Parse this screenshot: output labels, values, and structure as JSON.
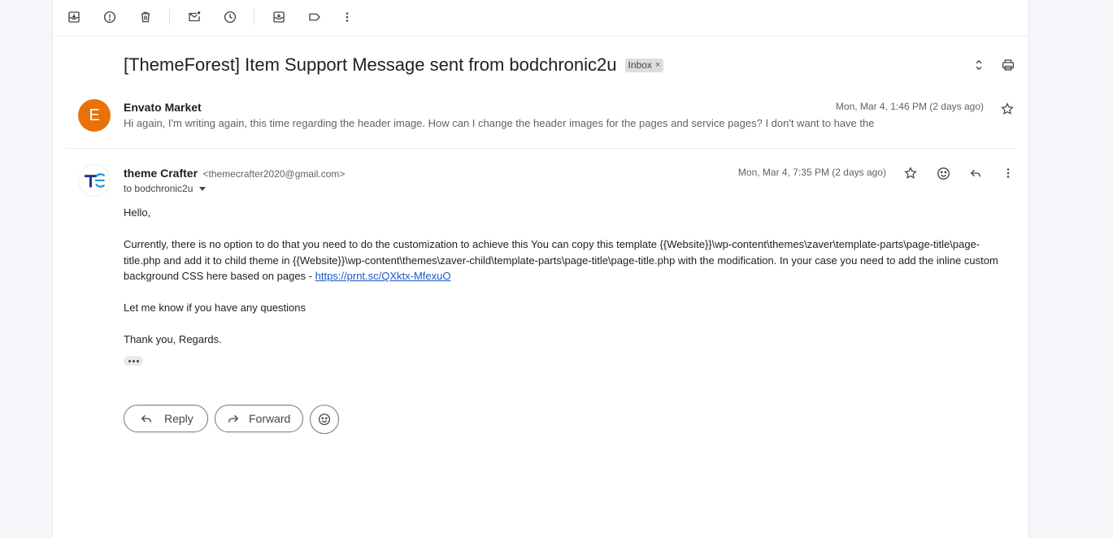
{
  "toolbar": {
    "icons": [
      "archive-icon",
      "report-spam-icon",
      "delete-icon",
      "mark-unread-icon",
      "snooze-icon",
      "move-to-icon",
      "label-icon",
      "more-vert-icon"
    ]
  },
  "thread": {
    "subject": "[ThemeForest] Item Support Message sent from bodchronic2u",
    "label": "Inbox",
    "label_remove": "×"
  },
  "message1": {
    "avatar_letter": "E",
    "sender": "Envato Market",
    "snippet": "Hi again, I'm writing again, this time regarding the header image. How can I change the header images for the pages and service pages? I don't want to have the",
    "date": "Mon, Mar 4, 1:46 PM (2 days ago)"
  },
  "message2": {
    "avatar_text": "TC",
    "sender_name": "theme Crafter",
    "sender_email": "<themecrafter2020@gmail.com>",
    "to": "to bodchronic2u",
    "date": "Mon, Mar 4, 7:35 PM (2 days ago)",
    "greeting": "Hello,",
    "paragraph": "Currently, there is no option to do that you need to do the customization to achieve this You can copy this template {{Website}}\\wp-content\\themes\\zaver\\template-parts\\page-title\\page-title.php and add it to child theme in {{Website}}\\wp-content\\themes\\zaver-child\\template-parts\\page-title\\page-title.php with the modification. In your case you need to add the inline custom background CSS here based on pages - ",
    "link": "https://prnt.sc/QXktx-MfexuO",
    "questions": "Let me know if you have any questions",
    "signoff": "Thank you, Regards."
  },
  "actions": {
    "reply": "Reply",
    "forward": "Forward"
  },
  "colors": {
    "avatar_e": "#e8710a",
    "link": "#1a56c6",
    "background": "#f4f6fa"
  }
}
